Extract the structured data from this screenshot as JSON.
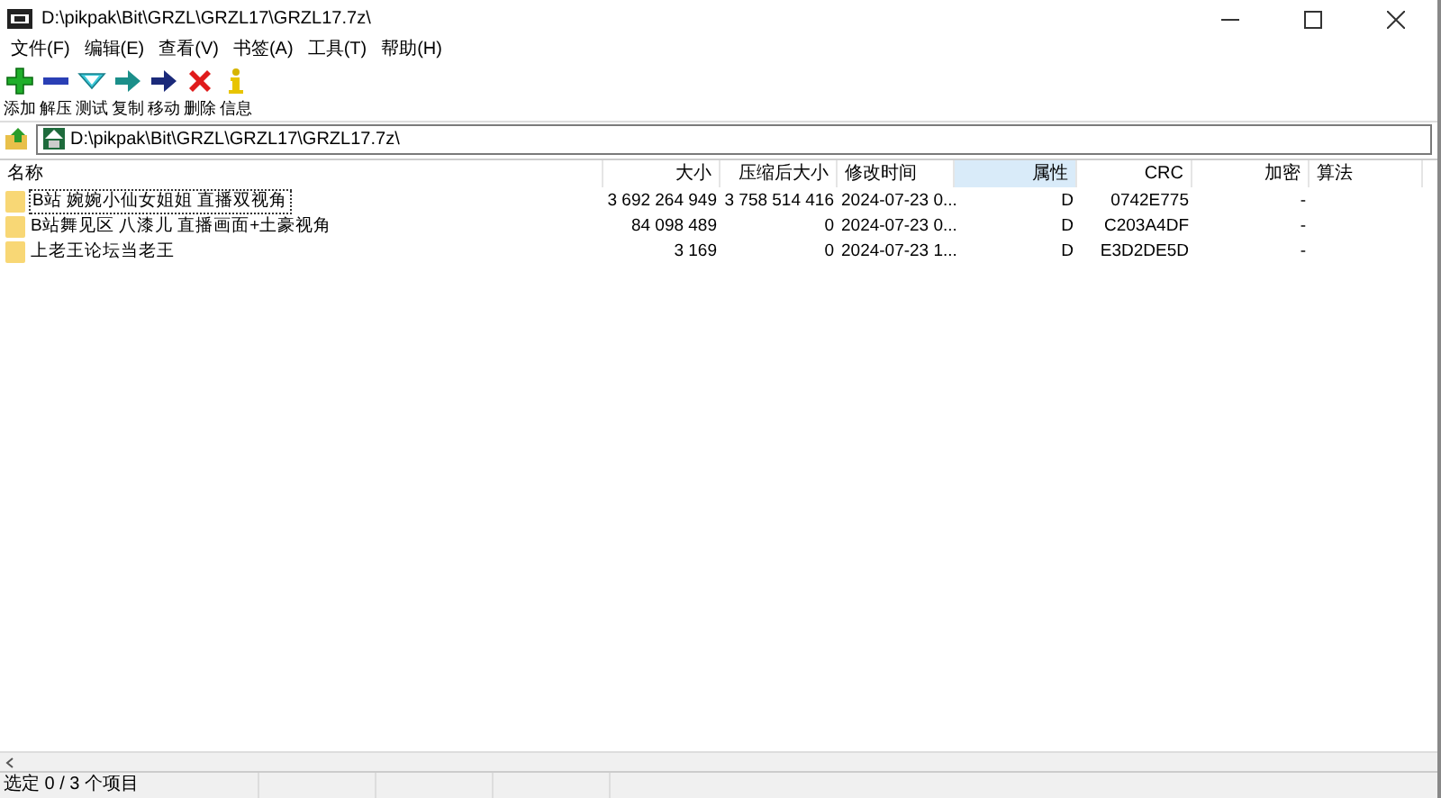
{
  "window": {
    "title": "D:\\pikpak\\Bit\\GRZL\\GRZL17\\GRZL17.7z\\"
  },
  "menu": [
    "文件(F)",
    "编辑(E)",
    "查看(V)",
    "书签(A)",
    "工具(T)",
    "帮助(H)"
  ],
  "toolbar": [
    {
      "kind": "add",
      "label": "添加"
    },
    {
      "kind": "extract",
      "label": "解压"
    },
    {
      "kind": "test",
      "label": "测试"
    },
    {
      "kind": "copy",
      "label": "复制"
    },
    {
      "kind": "move",
      "label": "移动"
    },
    {
      "kind": "delete",
      "label": "删除"
    },
    {
      "kind": "info",
      "label": "信息"
    }
  ],
  "address": {
    "value": "D:\\pikpak\\Bit\\GRZL\\GRZL17\\GRZL17.7z\\"
  },
  "table": {
    "columns": [
      {
        "label": "名称",
        "sorted": false
      },
      {
        "label": "大小",
        "sorted": false
      },
      {
        "label": "压缩后大小",
        "sorted": false
      },
      {
        "label": "修改时间",
        "sorted": false
      },
      {
        "label": "属性",
        "sorted": true
      },
      {
        "label": "CRC",
        "sorted": false
      },
      {
        "label": "加密",
        "sorted": false
      },
      {
        "label": "算法",
        "sorted": false
      }
    ],
    "rows": [
      {
        "focused": true,
        "cells": [
          "B站 婉婉小仙女姐姐 直播双视角",
          "3 692 264 949",
          "3 758 514 416",
          "2024-07-23 0...",
          "D",
          "0742E775",
          "-"
        ]
      },
      {
        "focused": false,
        "cells": [
          "B站舞见区 八漆儿 直播画面+土豪视角",
          "84 098 489",
          "0",
          "2024-07-23 0...",
          "D",
          "C203A4DF",
          "-"
        ]
      },
      {
        "focused": false,
        "cells": [
          "上老王论坛当老王",
          "3 169",
          "0",
          "2024-07-23 1...",
          "D",
          "E3D2DE5D",
          "-"
        ]
      }
    ]
  },
  "status_bar": [
    "选定 0 / 3 个项目"
  ]
}
